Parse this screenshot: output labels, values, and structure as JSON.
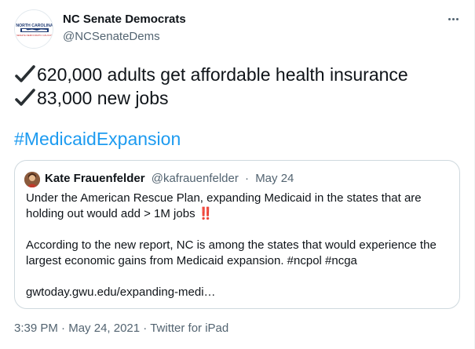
{
  "author": {
    "name": "NC Senate Democrats",
    "handle": "@NCSenateDems",
    "avatar_text_top": "NORTH CAROLINA",
    "avatar_text_sub": "SENATE DEMOCRATIC CAUCUS"
  },
  "tweet": {
    "line1": "620,000 adults get affordable health insurance",
    "line2": "83,000 new jobs",
    "hashtag": "#MedicaidExpansion"
  },
  "quote": {
    "name": "Kate Frauenfelder",
    "handle": "@kafrauenfelder",
    "date_sep": "·",
    "date": "May 24",
    "para1": "Under the American Rescue Plan, expanding Medicaid in the states that are holding out would add > 1M jobs",
    "emoji": "‼️",
    "para2": "According to the new report, NC is among the states that would experience the largest economic gains from Medicaid expansion. #ncpol #ncga",
    "link": "gwtoday.gwu.edu/expanding-medi…"
  },
  "footer": {
    "time": "3:39 PM",
    "sep1": "·",
    "date": "May 24, 2021",
    "sep2": "·",
    "source": "Twitter for iPad"
  },
  "colors": {
    "link": "#1d9bf0",
    "secondary": "#536471",
    "border": "#cfd9de"
  },
  "icons": [
    "check-mark-icon",
    "more-options-icon"
  ]
}
